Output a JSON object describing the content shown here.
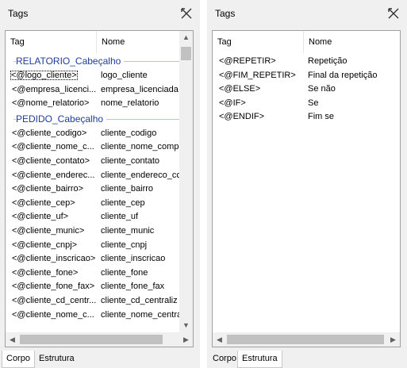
{
  "left": {
    "title": "Tags",
    "columns": [
      "Tag",
      "Nome"
    ],
    "groups": [
      {
        "label": "RELATORIO_Cabeçalho",
        "rows": [
          {
            "tag": "<@logo_cliente>",
            "nome": "logo_cliente"
          },
          {
            "tag": "<@empresa_licenci...",
            "nome": "empresa_licenciada"
          },
          {
            "tag": "<@nome_relatorio>",
            "nome": "nome_relatorio"
          }
        ]
      },
      {
        "label": "PEDIDO_Cabeçalho",
        "rows": [
          {
            "tag": "<@cliente_codigo>",
            "nome": "cliente_codigo"
          },
          {
            "tag": "<@cliente_nome_c...",
            "nome": "cliente_nome_compl"
          },
          {
            "tag": "<@cliente_contato>",
            "nome": "cliente_contato"
          },
          {
            "tag": "<@cliente_enderec...",
            "nome": "cliente_endereco_cc"
          },
          {
            "tag": "<@cliente_bairro>",
            "nome": "cliente_bairro"
          },
          {
            "tag": "<@cliente_cep>",
            "nome": "cliente_cep"
          },
          {
            "tag": "<@cliente_uf>",
            "nome": "cliente_uf"
          },
          {
            "tag": "<@cliente_munic>",
            "nome": "cliente_munic"
          },
          {
            "tag": "<@cliente_cnpj>",
            "nome": "cliente_cnpj"
          },
          {
            "tag": "<@cliente_inscricao>",
            "nome": "cliente_inscricao"
          },
          {
            "tag": "<@cliente_fone>",
            "nome": "cliente_fone"
          },
          {
            "tag": "<@cliente_fone_fax>",
            "nome": "cliente_fone_fax"
          },
          {
            "tag": "<@cliente_cd_centr...",
            "nome": "cliente_cd_centraliz"
          },
          {
            "tag": "<@cliente_nome_c...",
            "nome": "cliente_nome_centra"
          }
        ]
      }
    ],
    "tabs": [
      "Corpo",
      "Estrutura"
    ],
    "active_tab": "Corpo"
  },
  "right": {
    "title": "Tags",
    "columns": [
      "Tag",
      "Nome"
    ],
    "rows": [
      {
        "tag": "<@REPETIR>",
        "nome": "Repetição"
      },
      {
        "tag": "<@FIM_REPETIR>",
        "nome": "Final da repetição"
      },
      {
        "tag": "<@ELSE>",
        "nome": "Se não"
      },
      {
        "tag": "<@IF>",
        "nome": "Se"
      },
      {
        "tag": "<@ENDIF>",
        "nome": "Fim se"
      }
    ],
    "tabs": [
      "Corpo",
      "Estrutura"
    ],
    "active_tab": "Estrutura"
  },
  "colors": {
    "group_label": "#1e3d9c",
    "panel_bg": "#f0f0f0",
    "list_bg": "#ffffff"
  },
  "icons": {
    "close": "close-pin-icon",
    "scroll_up": "chevron-up-icon",
    "scroll_down": "chevron-down-icon",
    "scroll_left": "chevron-left-icon",
    "scroll_right": "chevron-right-icon"
  }
}
